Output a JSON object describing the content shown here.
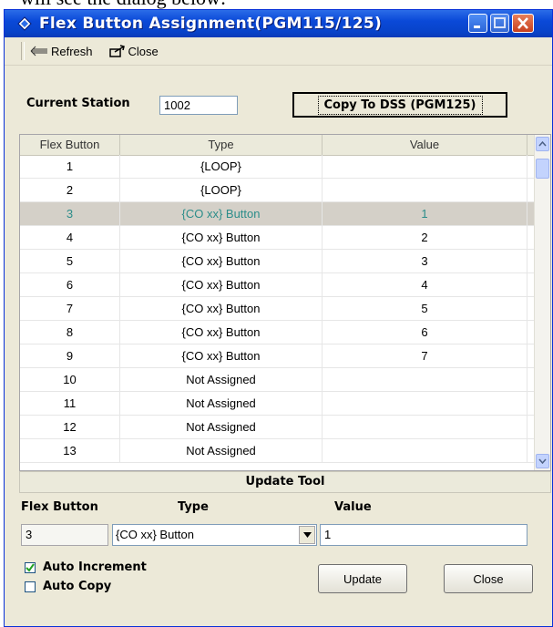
{
  "document_fragment": "will see the dialog below:",
  "window": {
    "title": "Flex Button Assignment(PGM115/125)"
  },
  "toolbar": {
    "refresh_label": "Refresh",
    "close_label": "Close"
  },
  "station": {
    "label": "Current Station",
    "value": "1002",
    "copy_button_label": "Copy To DSS (PGM125)"
  },
  "grid": {
    "columns": [
      "Flex Button",
      "Type",
      "Value"
    ],
    "rows": [
      {
        "button": "1",
        "type": "{LOOP}",
        "value": ""
      },
      {
        "button": "2",
        "type": "{LOOP}",
        "value": ""
      },
      {
        "button": "3",
        "type": "{CO xx} Button",
        "value": "1",
        "selected": true
      },
      {
        "button": "4",
        "type": "{CO xx} Button",
        "value": "2"
      },
      {
        "button": "5",
        "type": "{CO xx} Button",
        "value": "3"
      },
      {
        "button": "6",
        "type": "{CO xx} Button",
        "value": "4"
      },
      {
        "button": "7",
        "type": "{CO xx} Button",
        "value": "5"
      },
      {
        "button": "8",
        "type": "{CO xx} Button",
        "value": "6"
      },
      {
        "button": "9",
        "type": "{CO xx} Button",
        "value": "7"
      },
      {
        "button": "10",
        "type": "Not Assigned",
        "value": ""
      },
      {
        "button": "11",
        "type": "Not Assigned",
        "value": ""
      },
      {
        "button": "12",
        "type": "Not Assigned",
        "value": ""
      },
      {
        "button": "13",
        "type": "Not Assigned",
        "value": ""
      }
    ]
  },
  "update_tool": {
    "header": "Update Tool",
    "flex_button_label": "Flex Button",
    "type_label": "Type",
    "value_label": "Value",
    "flex_button_value": "3",
    "type_value": "{CO xx} Button",
    "value_value": "1",
    "auto_increment_label": "Auto Increment",
    "auto_increment_checked": true,
    "auto_copy_label": "Auto Copy",
    "auto_copy_checked": false,
    "update_button_label": "Update",
    "close_button_label": "Close"
  }
}
